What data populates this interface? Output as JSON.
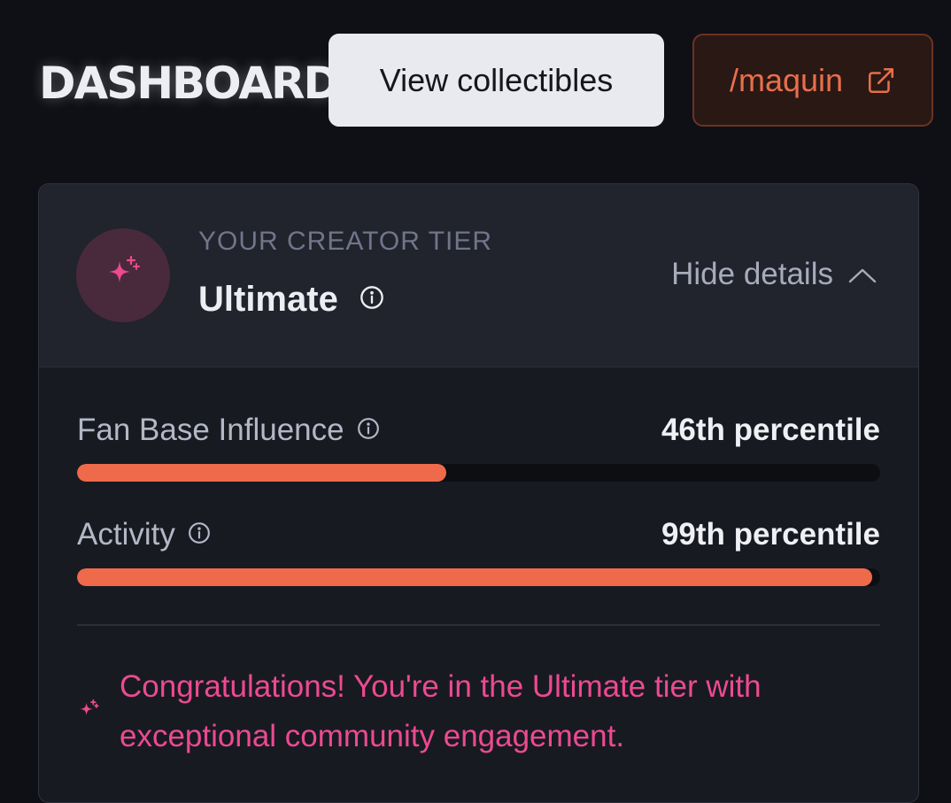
{
  "header": {
    "title": "DASHBOARD",
    "view_collectibles_label": "View collectibles",
    "handle_label": "/maquin",
    "handle_icon": "external-link-icon"
  },
  "tier": {
    "eyebrow": "YOUR CREATOR TIER",
    "name": "Ultimate",
    "icon": "sparkles-icon",
    "toggle_label": "Hide details"
  },
  "metrics": [
    {
      "label": "Fan Base Influence",
      "value": "46th percentile",
      "progress": 0.46
    },
    {
      "label": "Activity",
      "value": "99th percentile",
      "progress": 0.99
    }
  ],
  "congrats": {
    "message": "Congratulations! You're in the Ultimate tier with exceptional community engagement."
  },
  "colors": {
    "accent_orange": "#ef6a4a",
    "accent_pink": "#ec4a91",
    "background": "#0f1015",
    "card": "#181a21"
  }
}
